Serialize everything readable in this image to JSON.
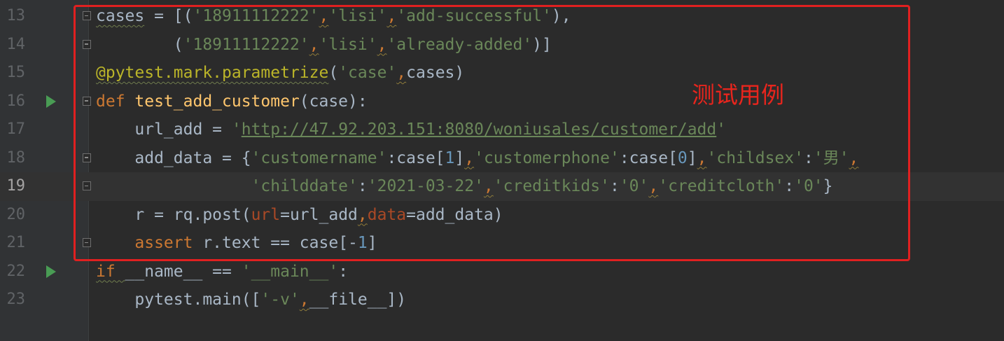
{
  "editor": {
    "colors": {
      "background": "#2b2b2b",
      "keyword": "#cc7832",
      "string": "#6a8759",
      "number": "#6897bb",
      "function_name": "#ffc66d",
      "decorator": "#bbb529",
      "keyword_argument": "#aa4926",
      "highlight_box": "#e02020",
      "run_icon": "#499c54"
    },
    "current_line": "19",
    "lines": [
      {
        "num": "13",
        "fold": true,
        "run": false,
        "code": [
          [
            "p",
            "cases"
          ],
          [
            "p",
            " = [("
          ],
          [
            "s",
            "'18911112222'"
          ],
          [
            "c",
            ","
          ],
          [
            "s",
            "'lisi'"
          ],
          [
            "c",
            ","
          ],
          [
            "s",
            "'add-successful'"
          ],
          [
            "p",
            "),"
          ]
        ]
      },
      {
        "num": "14",
        "fold": true,
        "run": false,
        "code": [
          [
            "p",
            "        ("
          ],
          [
            "s",
            "'18911112222'"
          ],
          [
            "c",
            ","
          ],
          [
            "s",
            "'lisi'"
          ],
          [
            "c",
            ","
          ],
          [
            "s",
            "'already-added'"
          ],
          [
            "p",
            ")]"
          ]
        ]
      },
      {
        "num": "15",
        "fold": false,
        "run": false,
        "code": [
          [
            "d",
            "@pytest.mark.parametrize"
          ],
          [
            "p",
            "("
          ],
          [
            "s",
            "'case'"
          ],
          [
            "c",
            ","
          ],
          [
            "p",
            "cases)"
          ]
        ]
      },
      {
        "num": "16",
        "fold": true,
        "run": true,
        "code": [
          [
            "k",
            "def "
          ],
          [
            "f",
            "test_add_customer"
          ],
          [
            "p",
            "(case):"
          ]
        ]
      },
      {
        "num": "17",
        "fold": false,
        "run": false,
        "code": [
          [
            "p",
            "    url_add = "
          ],
          [
            "s",
            "'"
          ],
          [
            "u",
            "http://47.92.203.151:8080/woniusales/customer/add"
          ],
          [
            "s",
            "'"
          ]
        ]
      },
      {
        "num": "18",
        "fold": true,
        "run": false,
        "code": [
          [
            "p",
            "    add_data = {"
          ],
          [
            "s",
            "'customername'"
          ],
          [
            "p",
            ":case["
          ],
          [
            "n",
            "1"
          ],
          [
            "p",
            "]"
          ],
          [
            "c",
            ","
          ],
          [
            "s",
            "'customerphone'"
          ],
          [
            "p",
            ":case["
          ],
          [
            "n",
            "0"
          ],
          [
            "p",
            "]"
          ],
          [
            "c",
            ","
          ],
          [
            "s",
            "'childsex'"
          ],
          [
            "p",
            ":"
          ],
          [
            "s",
            "'男'"
          ],
          [
            "c",
            ","
          ]
        ]
      },
      {
        "num": "19",
        "fold": true,
        "run": false,
        "code": [
          [
            "p",
            "                "
          ],
          [
            "s",
            "'childdate'"
          ],
          [
            "p",
            ":"
          ],
          [
            "s",
            "'2021-03-22'"
          ],
          [
            "c",
            ","
          ],
          [
            "s",
            "'creditkids'"
          ],
          [
            "p",
            ":"
          ],
          [
            "s",
            "'0'"
          ],
          [
            "c",
            ","
          ],
          [
            "s",
            "'creditcloth'"
          ],
          [
            "p",
            ":"
          ],
          [
            "s",
            "'0'"
          ],
          [
            "p",
            "}"
          ]
        ]
      },
      {
        "num": "20",
        "fold": false,
        "run": false,
        "code": [
          [
            "p",
            "    r = rq.post("
          ],
          [
            "a",
            "url"
          ],
          [
            "p",
            "=url_add"
          ],
          [
            "c",
            ","
          ],
          [
            "a",
            "data"
          ],
          [
            "p",
            "=add_data)"
          ]
        ]
      },
      {
        "num": "21",
        "fold": true,
        "run": false,
        "code": [
          [
            "k",
            "    assert "
          ],
          [
            "p",
            "r.text == case[-"
          ],
          [
            "n",
            "1"
          ],
          [
            "p",
            "]"
          ]
        ]
      },
      {
        "num": "22",
        "fold": false,
        "run": true,
        "code": [
          [
            "k",
            "if "
          ],
          [
            "p",
            "__name__ == "
          ],
          [
            "s",
            "'__main__'"
          ],
          [
            "p",
            ":"
          ]
        ]
      },
      {
        "num": "23",
        "fold": false,
        "run": false,
        "code": [
          [
            "p",
            "    pytest.main(["
          ],
          [
            "s",
            "'-v'"
          ],
          [
            "c",
            ","
          ],
          [
            "p",
            "__file__])"
          ]
        ]
      }
    ]
  },
  "annotation": {
    "text": "测试用例"
  }
}
